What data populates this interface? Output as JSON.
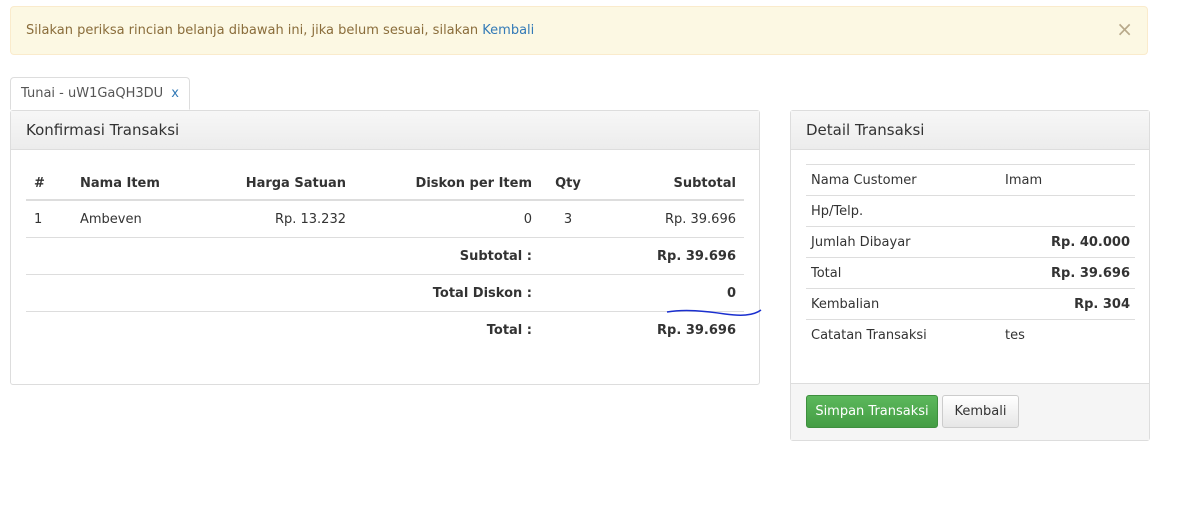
{
  "alert": {
    "text": "Silakan periksa rincian belanja dibawah ini, jika belum sesuai, silakan ",
    "link": "Kembali",
    "close": "×"
  },
  "tab": {
    "label": "Tunai - uW1GaQH3DU",
    "close": "x"
  },
  "left_panel": {
    "title": "Konfirmasi Transaksi",
    "columns": [
      "#",
      "Nama Item",
      "Harga Satuan",
      "Diskon per Item",
      "Qty",
      "Subtotal"
    ],
    "rows": [
      {
        "no": "1",
        "item": "Ambeven",
        "price": "Rp. 13.232",
        "discount": "0",
        "qty": "3",
        "subtotal": "Rp. 39.696"
      }
    ],
    "summary": {
      "subtotal_label": "Subtotal :",
      "subtotal_value": "Rp. 39.696",
      "discount_label": "Total Diskon :",
      "discount_value": "0",
      "total_label": "Total :",
      "total_value": "Rp. 39.696"
    }
  },
  "right_panel": {
    "title": "Detail Transaksi",
    "rows": [
      {
        "label": "Nama Customer",
        "value": "Imam"
      },
      {
        "label": "Hp/Telp.",
        "value": ""
      },
      {
        "label": "Jumlah Dibayar",
        "value": "Rp. 40.000"
      },
      {
        "label": "Total",
        "value": "Rp. 39.696"
      },
      {
        "label": "Kembalian",
        "value": "Rp. 304"
      },
      {
        "label": "Catatan Transaksi",
        "value": "tes"
      }
    ],
    "save_button": "Simpan Transaksi",
    "back_button": "Kembali"
  },
  "colors": {
    "alert_bg": "#fcf8e3",
    "alert_text": "#8a6d3b",
    "link": "#337ab7",
    "success": "#5cb85c",
    "scribble": "#1a2fcf"
  }
}
